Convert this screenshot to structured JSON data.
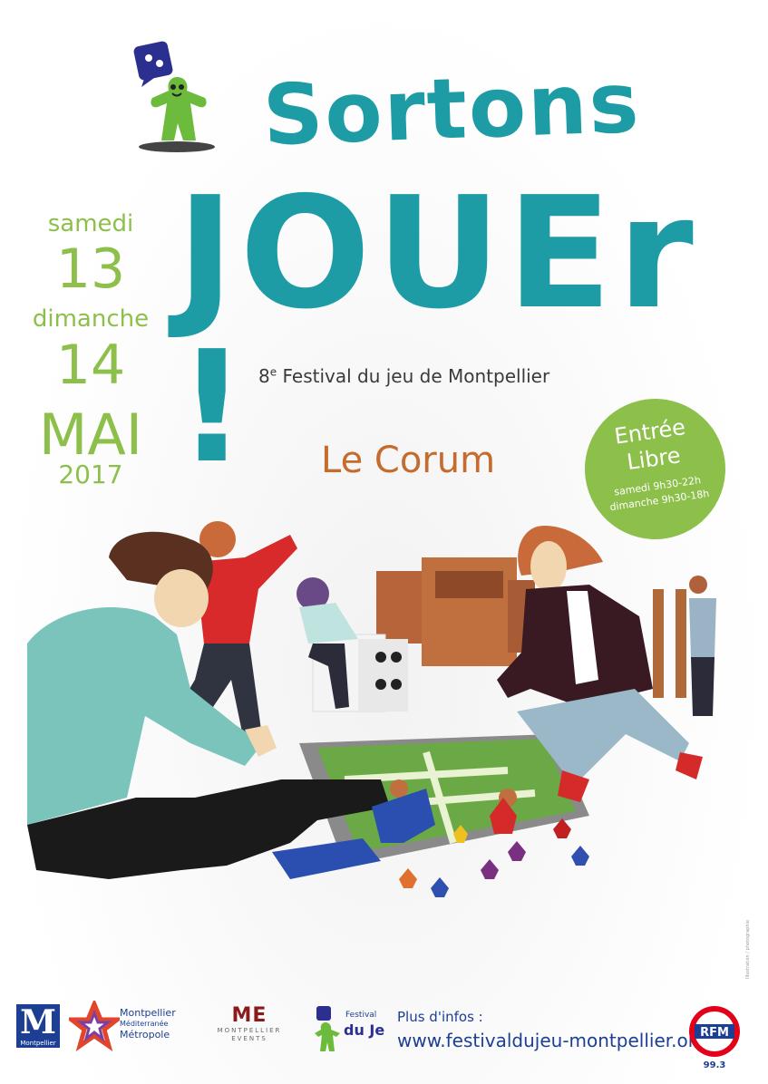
{
  "title": {
    "line1": "Sortons",
    "line2": "JOUEr !"
  },
  "dates": {
    "day1_label": "samedi",
    "day1_num": "13",
    "day2_label": "dimanche",
    "day2_num": "14",
    "month": "MAI",
    "year": "2017"
  },
  "subtitle": {
    "ordinal": "8",
    "ordinal_sup": "e",
    "text": " Festival du jeu de Montpellier"
  },
  "venue": "Le Corum",
  "badge": {
    "line1": "Entrée",
    "line2": "Libre",
    "line3": "samedi 9h30-22h",
    "line4": "dimanche 9h30-18h"
  },
  "footer": {
    "metro_logo_label": "Montpellier",
    "metro_line1": "Montpellier",
    "metro_line2": "Méditerranée",
    "metro_line3": "Métropole",
    "events_mark": "ME",
    "events_line1": "MONTPELLIER",
    "events_line2": "EVENTS",
    "festival_logo_line1": "Festival",
    "festival_logo_line2": "du Jeu",
    "info_label": "Plus d'infos :",
    "info_url": "www.festivaldujeu-montpellier.org",
    "rfm_label": "RFM",
    "rfm_freq": "99.3"
  },
  "colors": {
    "teal": "#1e9ca6",
    "green": "#8dc04b",
    "orange": "#c56b2d",
    "navy": "#1c3f94"
  },
  "icons": [
    "dice-mascot-icon",
    "meeple-icon",
    "star-logo-icon",
    "rfm-logo-icon"
  ]
}
